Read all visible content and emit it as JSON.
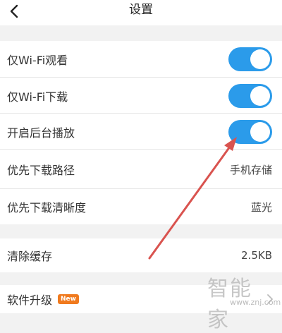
{
  "header": {
    "title": "设置",
    "back_icon": "chevron-left-icon"
  },
  "settings": {
    "wifi_watch": {
      "label": "仅Wi-Fi观看",
      "enabled": true
    },
    "wifi_download": {
      "label": "仅Wi-Fi下载",
      "enabled": true
    },
    "background_play": {
      "label": "开启后台播放",
      "enabled": true
    },
    "download_path": {
      "label": "优先下载路径",
      "value": "手机存储"
    },
    "download_quality": {
      "label": "优先下载清晰度",
      "value": "蓝光"
    },
    "clear_cache": {
      "label": "清除缓存",
      "value": "2.5KB"
    },
    "software_upgrade": {
      "label": "软件升级",
      "badge": "New"
    }
  },
  "watermark": {
    "text": "智能家",
    "sub": "www.znj.com"
  },
  "colors": {
    "toggle_on": "#2b9bea",
    "badge": "#f07a1e",
    "annotation_arrow": "#d9534f"
  }
}
